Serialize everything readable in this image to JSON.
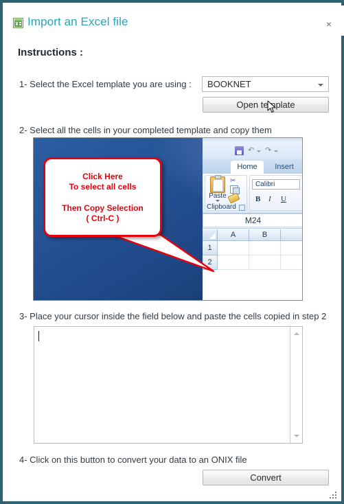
{
  "window": {
    "title": "Import an Excel file",
    "title_icon": "excel-file-icon",
    "close_label": "×",
    "border_color": "#2f6374",
    "title_color": "#2aa3bd"
  },
  "instructions": {
    "heading": "Instructions :",
    "step1": "1- Select the Excel template you are using :",
    "step2": "2- Select all the cells in your completed template and copy them",
    "step3": "3- Place your cursor inside the field below and paste the cells copied in step 2",
    "step4": "4- Click on this button to convert your data to an ONIX file"
  },
  "template_select": {
    "value": "BOOKNET",
    "options": [
      "BOOKNET"
    ]
  },
  "buttons": {
    "open_template": "Open template",
    "convert": "Convert"
  },
  "paste_field": {
    "value": "",
    "placeholder": ""
  },
  "screenshot": {
    "callout": {
      "line1": "Click Here",
      "line2": "To select all cells",
      "line3": "Then Copy Selection",
      "line4": "( Ctrl-C )",
      "color": "#e8000c"
    },
    "excel": {
      "tabs": [
        "Home",
        "Insert"
      ],
      "active_tab": "Home",
      "clipboard_group": "Clipboard",
      "paste_label": "Paste",
      "font_name": "Calibri",
      "bold": "B",
      "italic": "I",
      "underline": "U",
      "name_box": "M24",
      "columns": [
        "A",
        "B"
      ],
      "rows": [
        "1",
        "2"
      ]
    }
  }
}
